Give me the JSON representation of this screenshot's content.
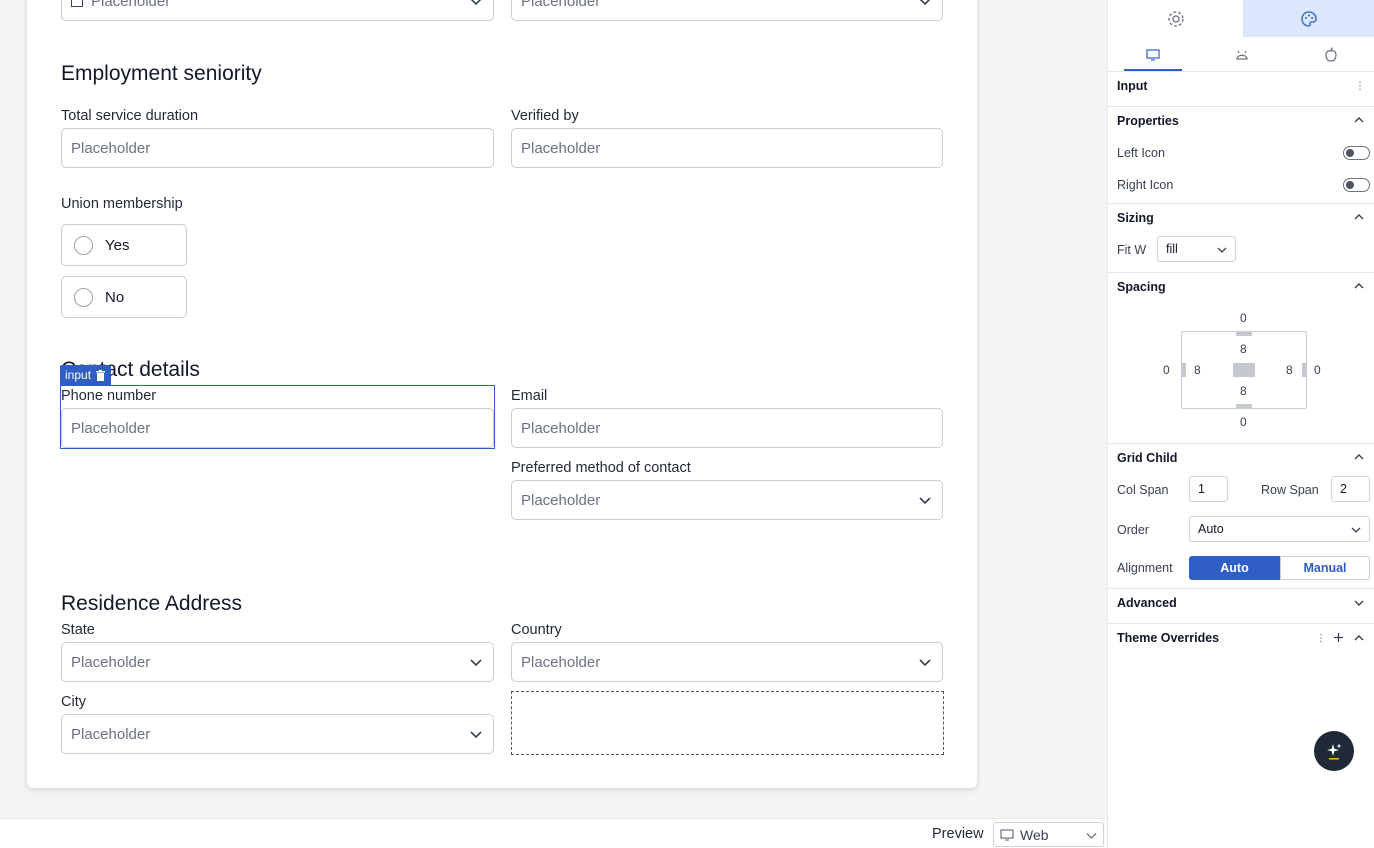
{
  "form": {
    "top_fields": [
      {
        "placeholder": "Placeholder"
      },
      {
        "placeholder": "Placeholder"
      }
    ],
    "employment": {
      "title": "Employment seniority",
      "total_label": "Total service duration",
      "total_placeholder": "Placeholder",
      "verified_label": "Verified by",
      "verified_placeholder": "Placeholder",
      "union_label": "Union membership",
      "options": [
        "Yes",
        "No"
      ]
    },
    "contact": {
      "title": "Contact details",
      "phone_label": "Phone number",
      "phone_placeholder": "Placeholder",
      "email_label": "Email",
      "email_placeholder": "Placeholder",
      "method_label": "Preferred method of contact",
      "method_placeholder": "Placeholder"
    },
    "selection_tag": "input",
    "address": {
      "title": "Residence Address",
      "state_label": "State",
      "state_placeholder": "Placeholder",
      "country_label": "Country",
      "country_placeholder": "Placeholder",
      "city_label": "City",
      "city_placeholder": "Placeholder"
    }
  },
  "footer": {
    "preview_label": "Preview",
    "preview_value": "Web"
  },
  "panel": {
    "tabs": [
      "settings-icon",
      "palette-icon"
    ],
    "device_tabs": [
      "desktop-icon",
      "android-icon",
      "apple-icon"
    ],
    "component_title": "Input",
    "properties": {
      "title": "Properties",
      "left_icon": "Left Icon",
      "right_icon": "Right Icon"
    },
    "sizing": {
      "title": "Sizing",
      "fit_label": "Fit W",
      "fit_value": "fill"
    },
    "spacing": {
      "title": "Spacing",
      "margin_top": "0",
      "margin_bottom": "0",
      "margin_left": "0",
      "margin_right": "0",
      "padding_top": "8",
      "padding_bottom": "8",
      "padding_left": "8",
      "padding_right": "8"
    },
    "grid_child": {
      "title": "Grid Child",
      "col_span_label": "Col Span",
      "col_span_value": "1",
      "row_span_label": "Row Span",
      "row_span_value": "2",
      "order_label": "Order",
      "order_value": "Auto",
      "alignment_label": "Alignment",
      "alignment_options": [
        "Auto",
        "Manual"
      ],
      "alignment_selected": "Auto"
    },
    "advanced": {
      "title": "Advanced"
    },
    "theme_overrides": {
      "title": "Theme Overrides"
    }
  },
  "colors": {
    "accent": "#2f5ec4",
    "active_tab_bg": "#dbe8fb",
    "fab_bg": "#1f2937",
    "fab_accent": "#f5b400"
  }
}
